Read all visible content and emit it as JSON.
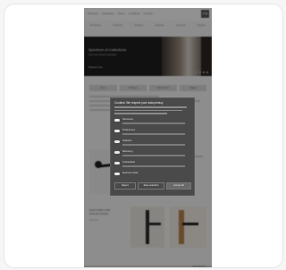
{
  "site": {
    "nav": [
      "Products",
      "Inspiration",
      "About",
      "Locations",
      "Contact"
    ],
    "logo": "FSB",
    "subnav": [
      "Products",
      "Projects",
      "Design",
      "Service",
      "Journal",
      "Search"
    ]
  },
  "hero": {
    "title": "Spectrum of Collections",
    "subtitle": "Door and window hardware",
    "link": "Discover now"
  },
  "tabs": [
    "Door",
    "Window",
    "Barrier-free",
    "Digital"
  ],
  "product_section": {
    "title": "DISCOVER OUR COLLECTIONS",
    "link": "View all"
  },
  "footer_label": "FSB DESIGN",
  "consent": {
    "title": "Cookies: We respect your data privacy",
    "options": [
      {
        "label": "Necessary"
      },
      {
        "label": "Preferences"
      },
      {
        "label": "Statistics"
      },
      {
        "label": "Marketing"
      },
      {
        "label": "Unclassified"
      },
      {
        "label": "External media"
      }
    ],
    "buttons": {
      "reject": "Reject",
      "save": "Save selection",
      "accept": "Accept all"
    }
  }
}
